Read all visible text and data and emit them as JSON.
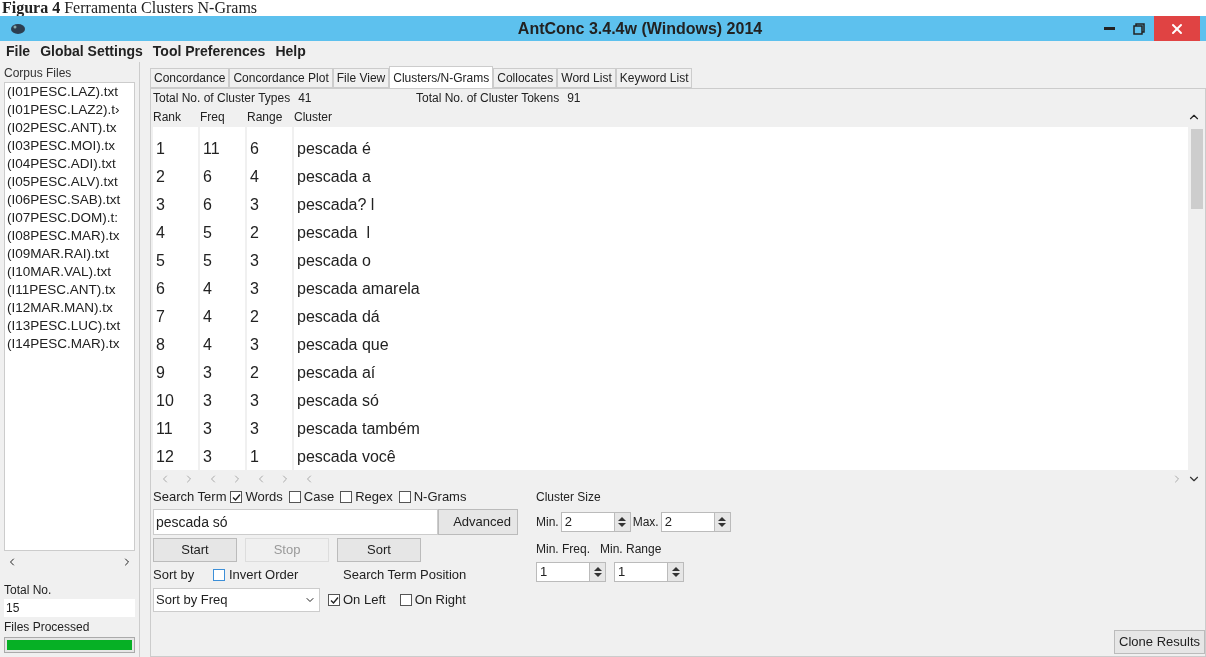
{
  "caption": {
    "label": "Figura 4",
    "text": "Ferramenta Clusters N-Grams"
  },
  "window": {
    "title": "AntConc 3.4.4w (Windows) 2014"
  },
  "menu": [
    "File",
    "Global Settings",
    "Tool Preferences",
    "Help"
  ],
  "corpus_files": {
    "label": "Corpus Files",
    "files": [
      "(I01PESC.LAZ).txt",
      "(I01PESC.LAZ2).t›",
      "(I02PESC.ANT).tx",
      "(I03PESC.MOI).tx",
      "(I04PESC.ADI).txt",
      "(I05PESC.ALV).txt",
      "(I06PESC.SAB).txt",
      "(I07PESC.DOM).t:",
      "(I08PESC.MAR).tx",
      "(I09MAR.RAI).txt",
      "(I10MAR.VAL).txt",
      "(I11PESC.ANT).tx",
      "(I12MAR.MAN).tx",
      "(I13PESC.LUC).txt",
      "(I14PESC.MAR).tx"
    ]
  },
  "total": {
    "label": "Total No.",
    "value": "15"
  },
  "files_processed": {
    "label": "Files Processed",
    "level": 1
  },
  "tabs": [
    {
      "label": "Concordance",
      "selected": false
    },
    {
      "label": "Concordance Plot",
      "selected": false
    },
    {
      "label": "File View",
      "selected": false
    },
    {
      "label": "Clusters/N-Grams",
      "selected": true
    },
    {
      "label": "Collocates",
      "selected": false
    },
    {
      "label": "Word List",
      "selected": false
    },
    {
      "label": "Keyword List",
      "selected": false
    }
  ],
  "stats": [
    {
      "label": "Total No. of Cluster Types",
      "value": "41"
    },
    {
      "label": "Total No. of Cluster Tokens",
      "value": "91"
    }
  ],
  "table": {
    "columns": [
      "Rank",
      "Freq",
      "Range",
      "Cluster"
    ],
    "rows": [
      [
        "1",
        "11",
        "6",
        "pescada é"
      ],
      [
        "2",
        "6",
        "4",
        "pescada a"
      ],
      [
        "3",
        "6",
        "3",
        "pescada? l"
      ],
      [
        "4",
        "5",
        "2",
        "pescada  l"
      ],
      [
        "5",
        "5",
        "3",
        "pescada o"
      ],
      [
        "6",
        "4",
        "3",
        "pescada amarela"
      ],
      [
        "7",
        "4",
        "2",
        "pescada dá"
      ],
      [
        "8",
        "4",
        "3",
        "pescada que"
      ],
      [
        "9",
        "3",
        "2",
        "pescada aí"
      ],
      [
        "10",
        "3",
        "3",
        "pescada só"
      ],
      [
        "11",
        "3",
        "3",
        "pescada também"
      ],
      [
        "12",
        "3",
        "1",
        "pescada você"
      ]
    ]
  },
  "search": {
    "label": "Search Term",
    "options": [
      {
        "label": "Words",
        "checked": true
      },
      {
        "label": "Case",
        "checked": false
      },
      {
        "label": "Regex",
        "checked": false
      },
      {
        "label": "N-Grams",
        "checked": false
      }
    ],
    "value": "pescada só",
    "advanced": "Advanced"
  },
  "buttons": [
    {
      "label": "Start",
      "disabled": false
    },
    {
      "label": "Stop",
      "disabled": true
    },
    {
      "label": "Sort",
      "disabled": false
    }
  ],
  "sort": {
    "label": "Sort by",
    "invert": {
      "label": "Invert Order",
      "checked": false
    },
    "value": "Sort by Freq"
  },
  "position": {
    "label": "Search Term Position",
    "options": [
      {
        "label": "On Left",
        "checked": true
      },
      {
        "label": "On Right",
        "checked": false
      }
    ]
  },
  "cluster_size": {
    "label": "Cluster Size",
    "min_label": "Min.",
    "min": "2",
    "max_label": "Max.",
    "max": "2"
  },
  "min_freq": {
    "label": "Min. Freq.",
    "value": "1"
  },
  "min_range": {
    "label": "Min. Range",
    "value": "1"
  },
  "clone_button": "Clone Results"
}
